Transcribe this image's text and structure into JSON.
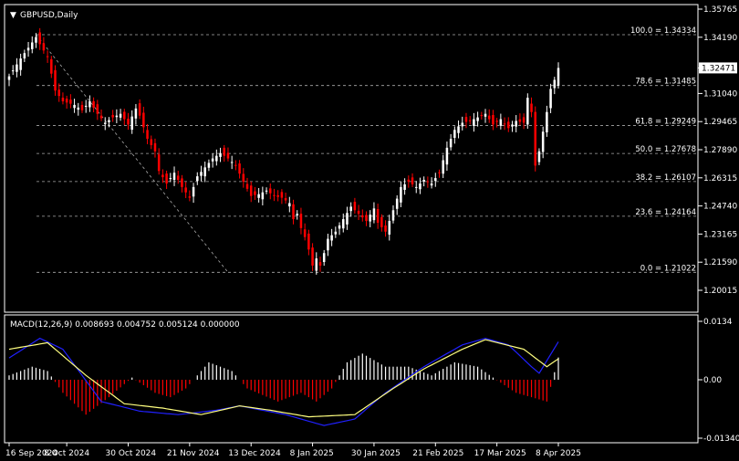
{
  "window": {
    "symbol_label": "GBPUSD,Daily",
    "macd_label": "MACD(12,26,9) 0.008693 0.004752 0.005124 0.000000"
  },
  "colors": {
    "background": "#000000",
    "frame": "#ffffff",
    "bull": "#ffffff",
    "bear": "#ff0000",
    "macd_line": "#2020ff",
    "signal_line": "#ffff80",
    "hist_pos": "#ffffff",
    "hist_neg": "#ff0000",
    "fib_line": "#aaaaaa",
    "current_price_box": "#ffffff"
  },
  "chart_data": [
    {
      "type": "candlestick",
      "title": "GBPUSD,Daily",
      "ylim": [
        1.20015,
        1.35765
      ],
      "y_ticks": [
        "1.35765",
        "1.34190",
        "1.32471",
        "1.31040",
        "1.29465",
        "1.27890",
        "1.26315",
        "1.24740",
        "1.23165",
        "1.21590",
        "1.20015"
      ],
      "current_price": "1.32471",
      "x_ticks": [
        "16 Sep 2024",
        "8 Oct 2024",
        "30 Oct 2024",
        "21 Nov 2024",
        "13 Dec 2024",
        "8 Jan 2025",
        "30 Jan 2025",
        "21 Feb 2025",
        "17 Mar 2025",
        "8 Apr 2025"
      ],
      "close_path": [
        [
          0,
          1.32
        ],
        [
          3,
          1.33
        ],
        [
          6,
          1.339
        ],
        [
          7,
          1.342
        ],
        [
          8,
          1.338
        ],
        [
          10,
          1.331
        ],
        [
          12,
          1.312
        ],
        [
          14,
          1.306
        ],
        [
          17,
          1.304
        ],
        [
          19,
          1.301
        ],
        [
          21,
          1.306
        ],
        [
          23,
          1.299
        ],
        [
          25,
          1.294
        ],
        [
          27,
          1.297
        ],
        [
          29,
          1.299
        ],
        [
          31,
          1.293
        ],
        [
          33,
          1.302
        ],
        [
          34,
          1.298
        ],
        [
          36,
          1.285
        ],
        [
          38,
          1.278
        ],
        [
          39,
          1.267
        ],
        [
          41,
          1.26
        ],
        [
          43,
          1.266
        ],
        [
          45,
          1.258
        ],
        [
          47,
          1.252
        ],
        [
          49,
          1.264
        ],
        [
          51,
          1.269
        ],
        [
          53,
          1.274
        ],
        [
          55,
          1.277
        ],
        [
          57,
          1.274
        ],
        [
          59,
          1.27
        ],
        [
          61,
          1.261
        ],
        [
          63,
          1.253
        ],
        [
          65,
          1.254
        ],
        [
          67,
          1.256
        ],
        [
          69,
          1.253
        ],
        [
          71,
          1.252
        ],
        [
          73,
          1.249
        ],
        [
          74,
          1.24
        ],
        [
          75,
          1.243
        ],
        [
          76,
          1.235
        ],
        [
          77,
          1.23
        ],
        [
          78,
          1.223
        ],
        [
          79,
          1.214
        ],
        [
          80,
          1.218
        ],
        [
          81,
          1.214
        ],
        [
          82,
          1.221
        ],
        [
          83,
          1.229
        ],
        [
          85,
          1.233
        ],
        [
          87,
          1.24
        ],
        [
          89,
          1.247
        ],
        [
          91,
          1.243
        ],
        [
          93,
          1.239
        ],
        [
          95,
          1.246
        ],
        [
          96,
          1.238
        ],
        [
          98,
          1.233
        ],
        [
          100,
          1.245
        ],
        [
          102,
          1.258
        ],
        [
          104,
          1.261
        ],
        [
          106,
          1.258
        ],
        [
          108,
          1.262
        ],
        [
          110,
          1.26
        ],
        [
          112,
          1.266
        ],
        [
          114,
          1.28
        ],
        [
          116,
          1.29
        ],
        [
          118,
          1.294
        ],
        [
          120,
          1.295
        ],
        [
          122,
          1.297
        ],
        [
          124,
          1.299
        ],
        [
          126,
          1.293
        ],
        [
          128,
          1.296
        ],
        [
          130,
          1.291
        ],
        [
          132,
          1.295
        ],
        [
          134,
          1.294
        ],
        [
          135,
          1.308
        ],
        [
          136,
          1.3
        ],
        [
          137,
          1.27
        ],
        [
          138,
          1.278
        ],
        [
          140,
          1.3
        ],
        [
          141,
          1.313
        ],
        [
          142,
          1.318
        ],
        [
          143,
          1.3247
        ]
      ],
      "fib_levels": [
        {
          "label": "100.0 = 1.34334",
          "price": 1.34334
        },
        {
          "label": "78.6 = 1.31485",
          "price": 1.31485
        },
        {
          "label": "61.8 = 1.29249",
          "price": 1.29249
        },
        {
          "label": "50.0 = 1.27678",
          "price": 1.27678
        },
        {
          "label": "38.2 = 1.26107",
          "price": 1.26107
        },
        {
          "label": "23.6 = 1.24164",
          "price": 1.24164
        },
        {
          "label": "0.0 = 1.21022",
          "price": 1.21022
        }
      ],
      "trendline": {
        "from": [
          7,
          1.3433
        ],
        "to": [
          57,
          1.2102
        ]
      }
    },
    {
      "type": "macd",
      "title": "MACD(12,26,9)",
      "ylim": [
        -0.013402,
        0.0134
      ],
      "y_ticks": [
        "0.0134",
        "0.00",
        "-0.013402"
      ],
      "macd_path": [
        [
          0,
          0.005
        ],
        [
          8,
          0.0095
        ],
        [
          14,
          0.007
        ],
        [
          24,
          -0.005
        ],
        [
          34,
          -0.0072
        ],
        [
          44,
          -0.008
        ],
        [
          54,
          -0.007
        ],
        [
          60,
          -0.006
        ],
        [
          72,
          -0.008
        ],
        [
          82,
          -0.0105
        ],
        [
          90,
          -0.009
        ],
        [
          98,
          -0.003
        ],
        [
          108,
          0.003
        ],
        [
          118,
          0.008
        ],
        [
          124,
          0.0095
        ],
        [
          130,
          0.008
        ],
        [
          136,
          0.003
        ],
        [
          138,
          0.0015
        ],
        [
          143,
          0.0087
        ]
      ],
      "signal_path": [
        [
          0,
          0.007
        ],
        [
          10,
          0.0085
        ],
        [
          20,
          0.001
        ],
        [
          30,
          -0.0055
        ],
        [
          40,
          -0.0065
        ],
        [
          50,
          -0.008
        ],
        [
          60,
          -0.006
        ],
        [
          68,
          -0.007
        ],
        [
          78,
          -0.0085
        ],
        [
          90,
          -0.008
        ],
        [
          100,
          -0.002
        ],
        [
          108,
          0.0025
        ],
        [
          118,
          0.007
        ],
        [
          124,
          0.0092
        ],
        [
          134,
          0.007
        ],
        [
          140,
          0.003
        ],
        [
          143,
          0.0048
        ]
      ],
      "histogram_path": [
        [
          0,
          0.001
        ],
        [
          6,
          0.003
        ],
        [
          10,
          0.002
        ],
        [
          14,
          -0.003
        ],
        [
          20,
          -0.008
        ],
        [
          26,
          -0.004
        ],
        [
          32,
          0.0005
        ],
        [
          38,
          -0.003
        ],
        [
          42,
          -0.004
        ],
        [
          46,
          -0.002
        ],
        [
          52,
          0.004
        ],
        [
          58,
          0.002
        ],
        [
          62,
          -0.002
        ],
        [
          70,
          -0.005
        ],
        [
          76,
          -0.003
        ],
        [
          80,
          -0.005
        ],
        [
          84,
          -0.002
        ],
        [
          88,
          0.004
        ],
        [
          92,
          0.006
        ],
        [
          98,
          0.003
        ],
        [
          104,
          0.003
        ],
        [
          110,
          0.001
        ],
        [
          116,
          0.004
        ],
        [
          122,
          0.003
        ],
        [
          126,
          0.0005
        ],
        [
          132,
          -0.003
        ],
        [
          136,
          -0.004
        ],
        [
          140,
          -0.005
        ],
        [
          143,
          0.0051
        ]
      ]
    }
  ]
}
